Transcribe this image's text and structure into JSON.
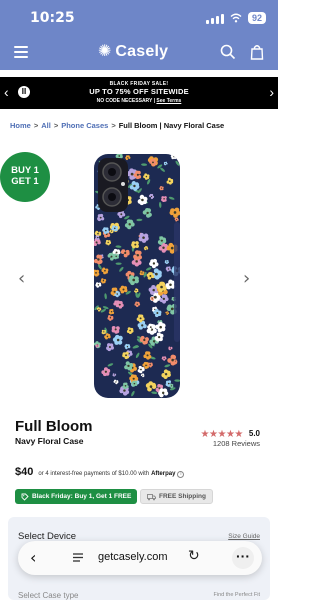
{
  "status_bar": {
    "time": "10:25",
    "battery": "92"
  },
  "header": {
    "brand": "Casely",
    "brand_mark": "✺"
  },
  "promo": {
    "line1": "BLACK FRIDAY SALE!",
    "line2": "UP TO 75% OFF SITEWIDE",
    "line3_prefix": "NO CODE NECESSARY | ",
    "line3_link": "See Terms",
    "prev_arrow": "‹",
    "next_arrow": "›",
    "pause_label": "II"
  },
  "breadcrumb": {
    "home": "Home",
    "all": "All",
    "category": "Phone Cases",
    "current": "Full Bloom | Navy Floral Case",
    "separator": ">"
  },
  "badge": {
    "line1": "BUY 1",
    "line2": "GET 1"
  },
  "gallery": {
    "prev": "‹",
    "next": "›"
  },
  "product": {
    "title": "Full Bloom",
    "subtitle": "Navy Floral Case",
    "stars": "★★★★★",
    "rating": "5.0",
    "reviews": "1208 Reviews",
    "price": "$40",
    "installments": "or 4 interest-free payments of $10.00 with",
    "afterpay": "Afterpay",
    "info": "i"
  },
  "tags": {
    "black_friday": "Black Friday: Buy 1, Get 1 FREE",
    "shipping": "FREE Shipping"
  },
  "options": {
    "select_device": "Select Device",
    "size_guide": "Size Guide",
    "case_type": "Select Case type",
    "perfect_case": "Find the Perfect Fit"
  },
  "browser": {
    "url": "getcasely.com",
    "back": "‹",
    "reload": "↻",
    "more": "···"
  },
  "colors": {
    "header_bg": "#6e86c8",
    "accent_green": "#1e8f43",
    "link_blue": "#4f6fb5",
    "star": "#d36a6a",
    "case_navy": "#1d2a52"
  },
  "icons": {
    "menu": "menu-icon",
    "search": "search-icon",
    "bag": "bag-icon",
    "tag": "tag-icon",
    "shipping": "shipping-icon"
  }
}
